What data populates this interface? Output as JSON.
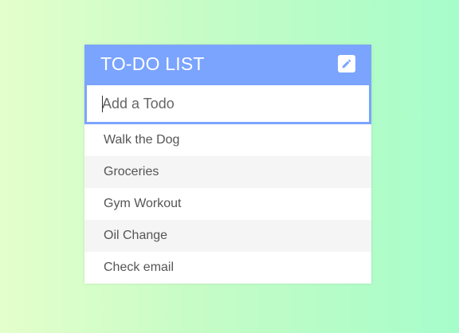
{
  "colors": {
    "header_bg": "#7ba4ff",
    "background_gradient": [
      "#e4ffcb",
      "#a6fdca"
    ],
    "alt_row": "#f5f5f5"
  },
  "header": {
    "title": "TO-DO LIST",
    "edit_icon": "pencil-icon"
  },
  "input": {
    "placeholder": "Add a Todo",
    "value": ""
  },
  "todos": [
    {
      "label": "Walk the Dog"
    },
    {
      "label": "Groceries"
    },
    {
      "label": "Gym Workout"
    },
    {
      "label": "Oil Change"
    },
    {
      "label": "Check email"
    }
  ]
}
